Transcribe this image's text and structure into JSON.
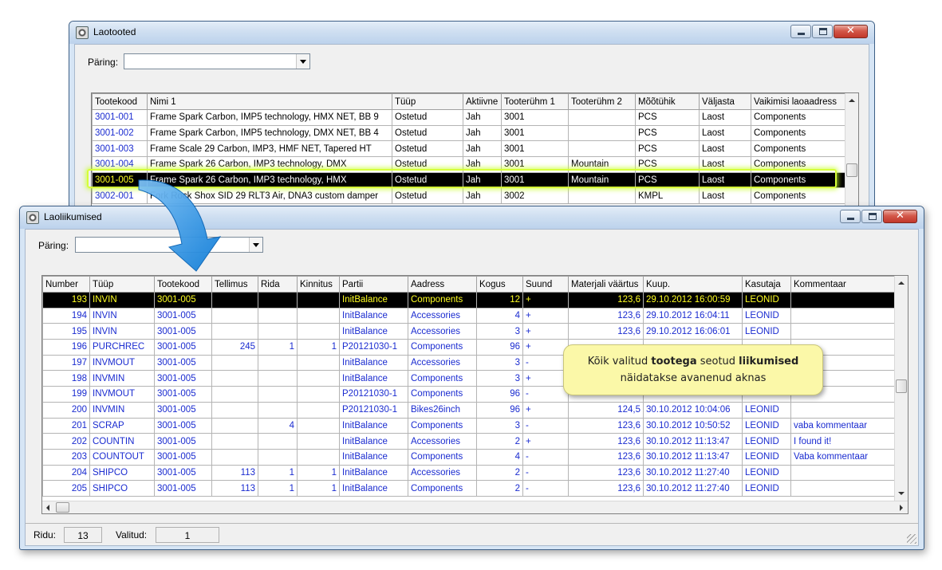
{
  "colors": {
    "title_gradient_top": "#e3edf8",
    "selection_bg": "#000000",
    "selection_text": "#ffff22",
    "link_blue": "#1a2bd0",
    "callout_bg": "#fbf8a8",
    "arrow_blue": "#1d8ce0",
    "glow": "#d6ff38"
  },
  "top_window": {
    "title": "Laotooted",
    "query": {
      "label": "Päring:",
      "value": ""
    },
    "table": {
      "columns": [
        "Tootekood",
        "Nimi 1",
        "Tüüp",
        "Aktiivne",
        "Tooterühm 1",
        "Tooterühm 2",
        "Mõõtühik",
        "Väljasta",
        "Vaikimisi laoaadress"
      ],
      "rows": [
        [
          "3001-001",
          "Frame Spark Carbon, IMP5 technology, HMX NET, BB 9",
          "Ostetud",
          "Jah",
          "3001",
          "",
          "PCS",
          "Laost",
          "Components"
        ],
        [
          "3001-002",
          "Frame Spark Carbon, IMP5 technology, DMX NET, BB 4",
          "Ostetud",
          "Jah",
          "3001",
          "",
          "PCS",
          "Laost",
          "Components"
        ],
        [
          "3001-003",
          "Frame Scale 29 Carbon, IMP3, HMF NET, Tapered HT",
          "Ostetud",
          "Jah",
          "3001",
          "",
          "PCS",
          "Laost",
          "Components"
        ],
        [
          "3001-004",
          "Frame Spark 26 Carbon, IMP3 technology, DMX",
          "Ostetud",
          "Jah",
          "3001",
          "Mountain",
          "PCS",
          "Laost",
          "Components"
        ],
        [
          "3001-005",
          "Frame Spark 26 Carbon, IMP3 technology, HMX",
          "Ostetud",
          "Jah",
          "3001",
          "Mountain",
          "PCS",
          "Laost",
          "Components"
        ],
        [
          "3002-001",
          "Fork Rock Shox SID 29 RLT3 Air, DNA3 custom damper",
          "Ostetud",
          "Jah",
          "3002",
          "",
          "KMPL",
          "Laost",
          "Components"
        ]
      ],
      "selected_row": 4
    }
  },
  "bottom_window": {
    "title": "Laoliikumised",
    "query": {
      "label": "Päring:",
      "value": ""
    },
    "table": {
      "columns": [
        "Number",
        "Tüüp",
        "Tootekood",
        "Tellimus",
        "Rida",
        "Kinnitus",
        "Partii",
        "Aadress",
        "Kogus",
        "Suund",
        "Materjali väärtus",
        "Kuup.",
        "Kasutaja",
        "Kommentaar"
      ],
      "rows": [
        [
          "193",
          "INVIN",
          "3001-005",
          "",
          "",
          "",
          "InitBalance",
          "Components",
          "12",
          "+",
          "123,6",
          "29.10.2012 16:00:59",
          "LEONID",
          ""
        ],
        [
          "194",
          "INVIN",
          "3001-005",
          "",
          "",
          "",
          "InitBalance",
          "Accessories",
          "4",
          "+",
          "123,6",
          "29.10.2012 16:04:11",
          "LEONID",
          ""
        ],
        [
          "195",
          "INVIN",
          "3001-005",
          "",
          "",
          "",
          "InitBalance",
          "Accessories",
          "3",
          "+",
          "123,6",
          "29.10.2012 16:06:01",
          "LEONID",
          ""
        ],
        [
          "196",
          "PURCHREC",
          "3001-005",
          "245",
          "1",
          "1",
          "P20121030-1",
          "Components",
          "96",
          "+",
          "",
          "",
          "",
          ""
        ],
        [
          "197",
          "INVMOUT",
          "3001-005",
          "",
          "",
          "",
          "InitBalance",
          "Accessories",
          "3",
          "-",
          "",
          "",
          "",
          ""
        ],
        [
          "198",
          "INVMIN",
          "3001-005",
          "",
          "",
          "",
          "InitBalance",
          "Components",
          "3",
          "+",
          "",
          "",
          "",
          ""
        ],
        [
          "199",
          "INVMOUT",
          "3001-005",
          "",
          "",
          "",
          "P20121030-1",
          "Components",
          "96",
          "-",
          "",
          "",
          "",
          ""
        ],
        [
          "200",
          "INVMIN",
          "3001-005",
          "",
          "",
          "",
          "P20121030-1",
          "Bikes26inch",
          "96",
          "+",
          "124,5",
          "30.10.2012 10:04:06",
          "LEONID",
          ""
        ],
        [
          "201",
          "SCRAP",
          "3001-005",
          "",
          "4",
          "",
          "InitBalance",
          "Components",
          "3",
          "-",
          "123,6",
          "30.10.2012 10:50:52",
          "LEONID",
          "vaba kommentaar"
        ],
        [
          "202",
          "COUNTIN",
          "3001-005",
          "",
          "",
          "",
          "InitBalance",
          "Accessories",
          "2",
          "+",
          "123,6",
          "30.10.2012 11:13:47",
          "LEONID",
          "I found it!"
        ],
        [
          "203",
          "COUNTOUT",
          "3001-005",
          "",
          "",
          "",
          "InitBalance",
          "Components",
          "4",
          "-",
          "123,6",
          "30.10.2012 11:13:47",
          "LEONID",
          "Vaba kommentaar"
        ],
        [
          "204",
          "SHIPCO",
          "3001-005",
          "113",
          "1",
          "1",
          "InitBalance",
          "Accessories",
          "2",
          "-",
          "123,6",
          "30.10.2012 11:27:40",
          "LEONID",
          ""
        ],
        [
          "205",
          "SHIPCO",
          "3001-005",
          "113",
          "1",
          "1",
          "InitBalance",
          "Components",
          "2",
          "-",
          "123,6",
          "30.10.2012 11:27:40",
          "LEONID",
          ""
        ]
      ],
      "selected_row": 0
    },
    "status": {
      "rows_label": "Ridu:",
      "rows_value": "13",
      "selected_label": "Valitud:",
      "selected_value": "1"
    }
  },
  "callout": {
    "line1_parts": [
      "Kõik valitud ",
      "tootega",
      " seotud ",
      "liikumised"
    ],
    "line2": "näidatakse avanenud aknas"
  }
}
